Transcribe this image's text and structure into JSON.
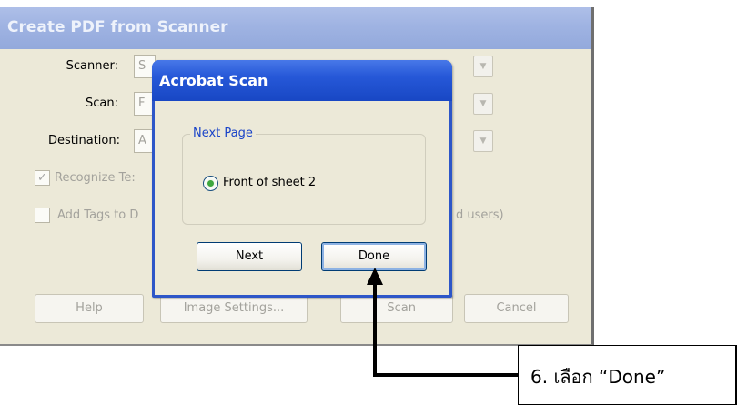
{
  "background_window": {
    "title": "Create PDF from Scanner",
    "scanner_label": "Scanner:",
    "scanner_value_partial": "S",
    "scan_label": "Scan:",
    "scan_value_partial": "F",
    "destination_label": "Destination:",
    "destination_value_partial": "A",
    "recognize_text_label_partial": "Recognize Te:",
    "add_tags_label_partial": "Add Tags to D",
    "add_tags_suffix_partial": "d users)",
    "help_button": "Help",
    "image_settings_button": "Image Settings...",
    "scan_button": "Scan",
    "cancel_button": "Cancel"
  },
  "dialog": {
    "title": "Acrobat Scan",
    "group_label": "Next Page",
    "radio_label": "Front of sheet 2",
    "next_button": "Next",
    "done_button": "Done"
  },
  "annotation": {
    "text": "6. เลือก “Done”"
  }
}
